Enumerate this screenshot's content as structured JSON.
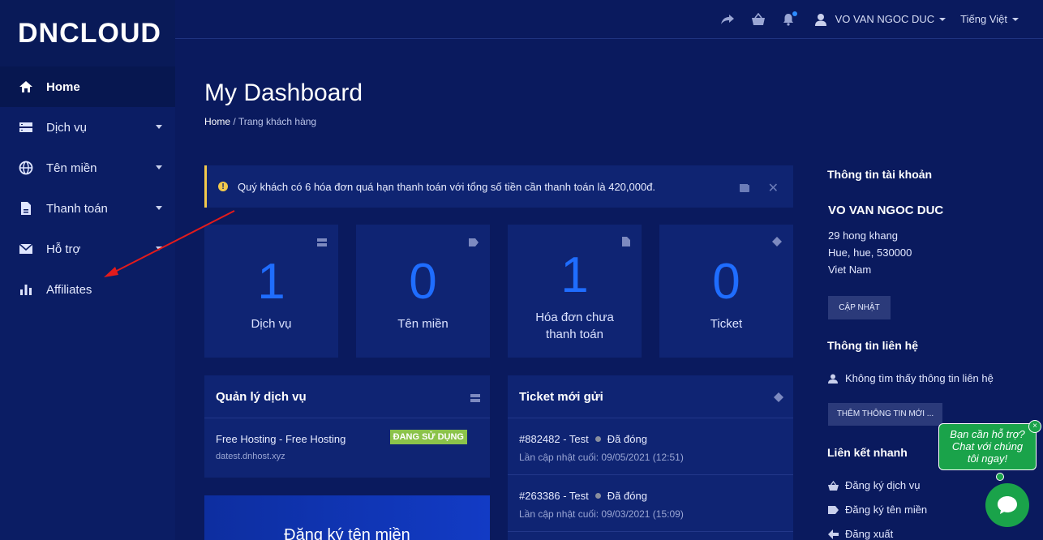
{
  "brand": {
    "logo": "DNCLOUD"
  },
  "sidebar": {
    "items": [
      {
        "label": "Home",
        "icon": "home-icon",
        "active": true
      },
      {
        "label": "Dịch vụ",
        "icon": "server-icon"
      },
      {
        "label": "Tên miền",
        "icon": "globe-icon"
      },
      {
        "label": "Thanh toán",
        "icon": "document-icon"
      },
      {
        "label": "Hỗ trợ",
        "icon": "envelope-icon"
      },
      {
        "label": "Affiliates",
        "icon": "bar-chart-icon"
      }
    ]
  },
  "topbar": {
    "user": "VO VAN NGOC DUC",
    "language": "Tiếng Việt"
  },
  "page": {
    "title": "My Dashboard",
    "breadcrumb_home": "Home",
    "breadcrumb_current": "Trang khách hàng"
  },
  "alert": {
    "text": "Quý khách có 6 hóa đơn quá hạn thanh toán với tổng số tiền cần thanh toán là 420,000đ."
  },
  "stats": [
    {
      "value": "1",
      "label": "Dịch vụ",
      "icon": "server-icon"
    },
    {
      "value": "0",
      "label": "Tên miền",
      "icon": "tag-icon"
    },
    {
      "value": "1",
      "label": "Hóa đơn chưa thanh toán",
      "icon": "document-icon"
    },
    {
      "value": "0",
      "label": "Ticket",
      "icon": "ticket-icon"
    }
  ],
  "services_panel": {
    "title": "Quản lý dịch vụ",
    "service_name": "Free Hosting - Free Hosting",
    "service_domain": "datest.dnhost.xyz",
    "service_status": "ĐANG SỬ DỤNG"
  },
  "tickets_panel": {
    "title": "Ticket mới gửi",
    "tickets": [
      {
        "id": "#882482 - Test",
        "status": "Đã đóng",
        "updated": "Lần cập nhật cuối: 09/05/2021 (12:51)"
      },
      {
        "id": "#263386 - Test",
        "status": "Đã đóng",
        "updated": "Lần cập nhật cuối: 09/03/2021 (15:09)"
      }
    ]
  },
  "register_banner": {
    "text": "Đăng ký tên miền"
  },
  "account": {
    "title": "Thông tin tài khoản",
    "name": "VO VAN NGOC DUC",
    "address1": "29 hong khang",
    "address2": "Hue, hue, 530000",
    "country": "Viet Nam",
    "update_button": "CẬP NHẬT"
  },
  "contact": {
    "title": "Thông tin liên hệ",
    "empty": "Không tìm thấy thông tin liên hệ",
    "add_button": "THÊM THÔNG TIN MỚI ..."
  },
  "quick_links": {
    "title": "Liên kết nhanh",
    "items": [
      {
        "label": "Đăng ký dịch vụ",
        "icon": "basket-icon"
      },
      {
        "label": "Đăng ký tên miền",
        "icon": "tag-icon"
      },
      {
        "label": "Đăng xuất",
        "icon": "logout-icon"
      }
    ]
  },
  "chat": {
    "line1": "Bạn cần hỗ trợ?",
    "line2": "Chat với chúng",
    "line3": "tôi ngay!",
    "close": "×"
  },
  "colors": {
    "accent": "#1f6dff",
    "background": "#0a1a5e",
    "card": "#0f2473",
    "success": "#8bc34a",
    "chat": "#1aa34a",
    "annotation_arrow": "#e31b1b"
  }
}
